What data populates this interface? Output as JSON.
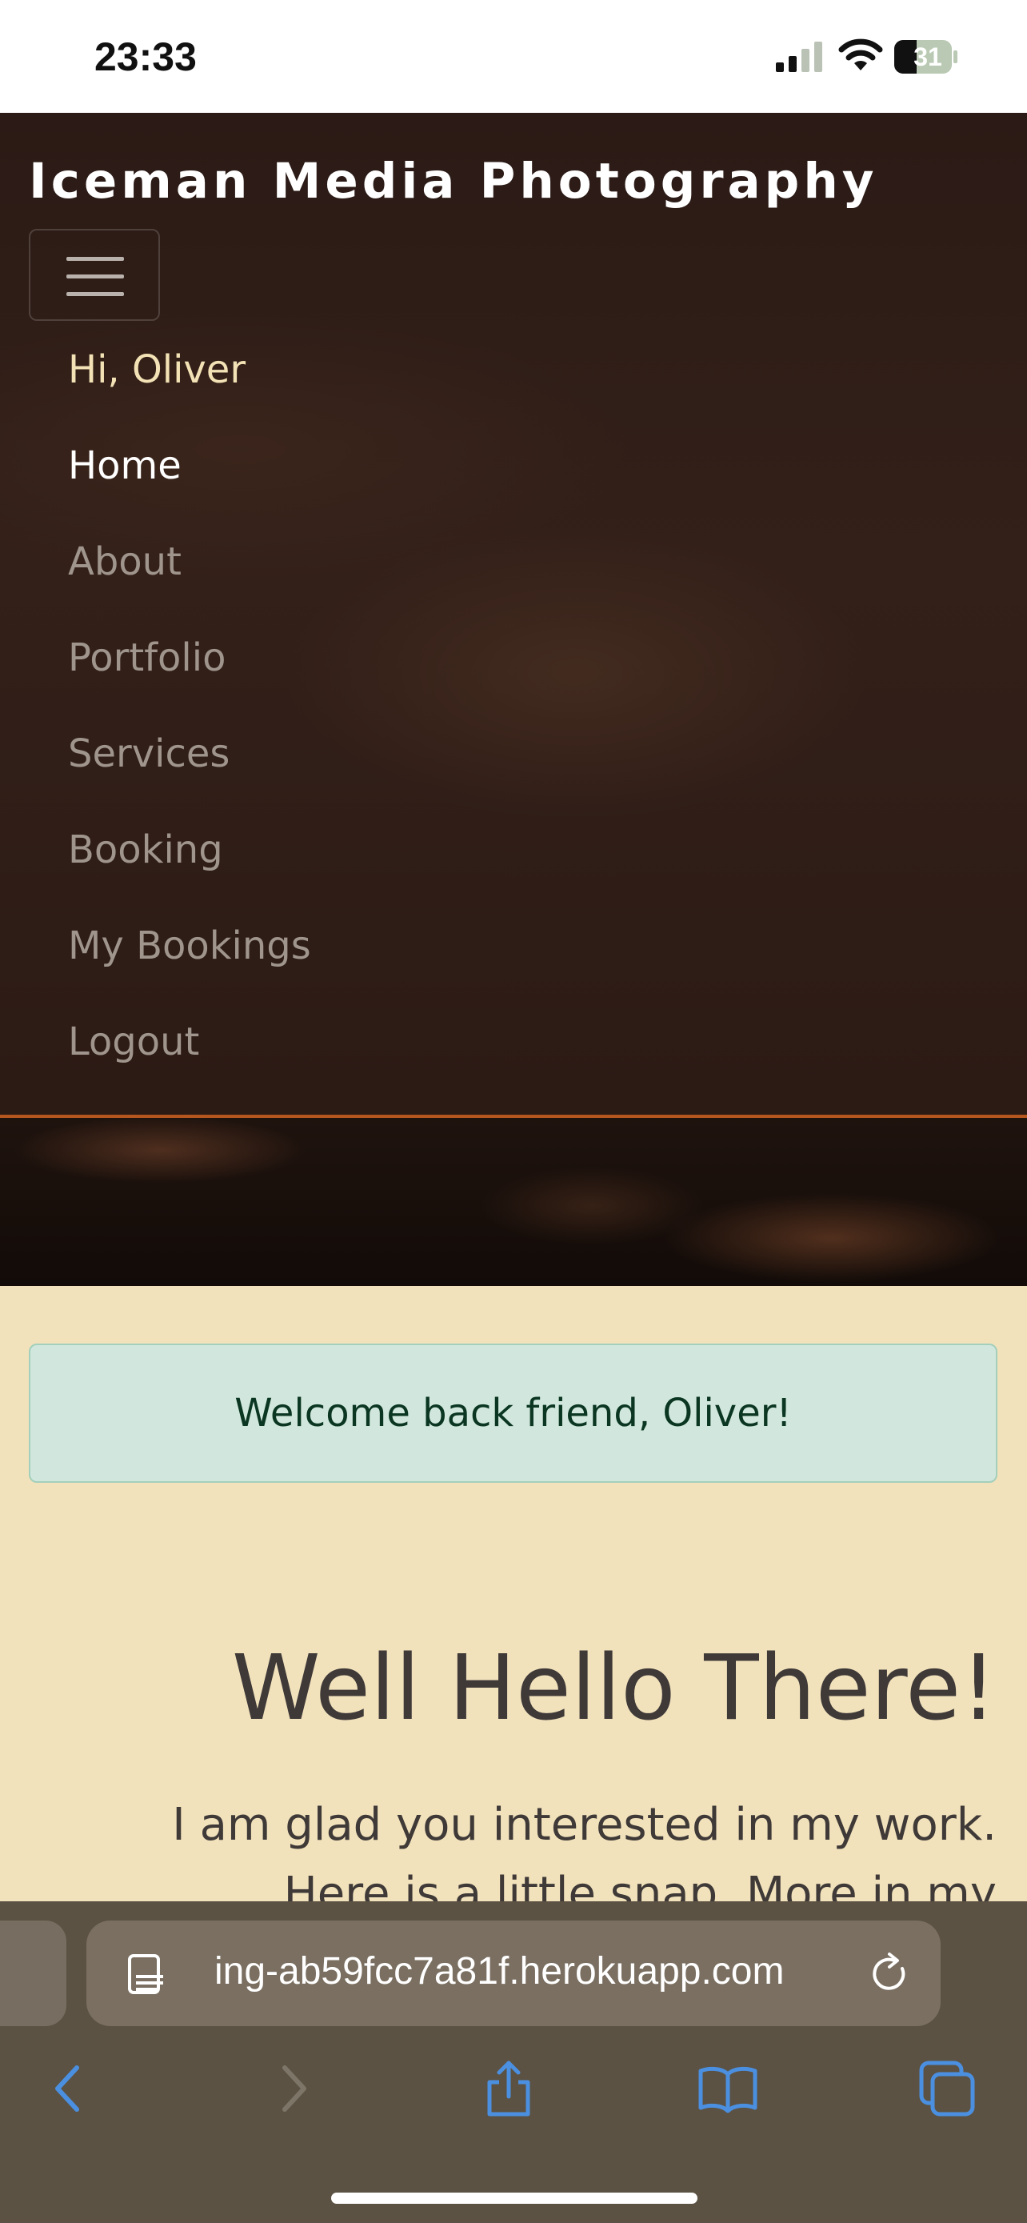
{
  "status_bar": {
    "time": "23:33",
    "battery_level": "31"
  },
  "navbar": {
    "brand": "Iceman Media Photography",
    "toggle_icon": "hamburger-icon",
    "items": [
      {
        "label": "Hi, Oliver",
        "kind": "greeting"
      },
      {
        "label": "Home",
        "kind": "active"
      },
      {
        "label": "About",
        "kind": "link"
      },
      {
        "label": "Portfolio",
        "kind": "link"
      },
      {
        "label": "Services",
        "kind": "link"
      },
      {
        "label": "Booking",
        "kind": "link"
      },
      {
        "label": "My Bookings",
        "kind": "link"
      },
      {
        "label": "Logout",
        "kind": "link"
      }
    ],
    "accent_color": "#b5561f"
  },
  "alert": {
    "message": "Welcome back friend, Oliver!"
  },
  "main": {
    "heading": "Well Hello There!",
    "intro_line1": "I am glad you interested in my work.",
    "intro_line2": "Here is a little snap. More in my"
  },
  "browser": {
    "url": "ing-ab59fcc7a81f.herokuapp.com",
    "icons": [
      "page-menu-icon",
      "reload-icon",
      "back-icon",
      "forward-icon",
      "share-icon",
      "bookmarks-icon",
      "tabs-icon"
    ]
  },
  "colors": {
    "page_background": "#f2e2bc",
    "alert_background": "#d1e7dd",
    "browser_accent": "#4b8fe0"
  }
}
